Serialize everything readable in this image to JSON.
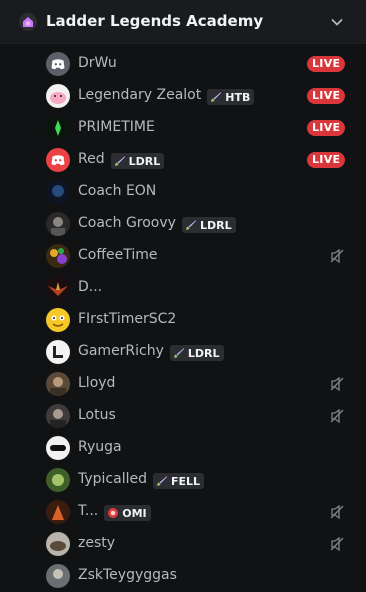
{
  "server": {
    "name": "Ladder Legends Academy",
    "icon": "home-flower-icon"
  },
  "colors": {
    "live": "#da373c",
    "text": "#b5bac1",
    "bg": "#111214"
  },
  "members": [
    {
      "name": "DrWu",
      "live": "LIVE",
      "avatar": "discord-logo-gray"
    },
    {
      "name": "Legendary Zealot",
      "tag": "HTB",
      "tag_icon": "sword-icon",
      "live": "LIVE",
      "avatar": "pink-pig"
    },
    {
      "name": "PRIMETIME",
      "live": "LIVE",
      "avatar": "green-figure"
    },
    {
      "name": "Red",
      "tag": "LDRL",
      "tag_icon": "sword-icon",
      "live": "LIVE",
      "avatar": "discord-logo-red"
    },
    {
      "name": "Coach EON",
      "avatar": "dark-blue-figure"
    },
    {
      "name": "Coach Groovy",
      "tag": "LDRL",
      "tag_icon": "sword-icon",
      "avatar": "portrait"
    },
    {
      "name": "CoffeeTime",
      "muted": true,
      "avatar": "colorful-art"
    },
    {
      "name": "D...",
      "avatar": "dark-wings"
    },
    {
      "name": "FIrstTimerSC2",
      "avatar": "yellow-face"
    },
    {
      "name": "GamerRichy",
      "tag": "LDRL",
      "tag_icon": "sword-icon",
      "avatar": "logo-white"
    },
    {
      "name": "Lloyd",
      "muted": true,
      "avatar": "photo"
    },
    {
      "name": "Lotus",
      "muted": true,
      "avatar": "photo-dark"
    },
    {
      "name": "Ryuga",
      "avatar": "white-mask"
    },
    {
      "name": "Typicalled",
      "tag": "FELL",
      "tag_icon": "sword-icon",
      "avatar": "green-art"
    },
    {
      "name": "T...",
      "tag": "OMI",
      "tag_icon": "red-circle-icon",
      "muted": true,
      "avatar": "orange-figure"
    },
    {
      "name": "zesty",
      "muted": true,
      "avatar": "hedgehog"
    },
    {
      "name": "ZskTeygyggas",
      "avatar": "gray-figure"
    }
  ]
}
